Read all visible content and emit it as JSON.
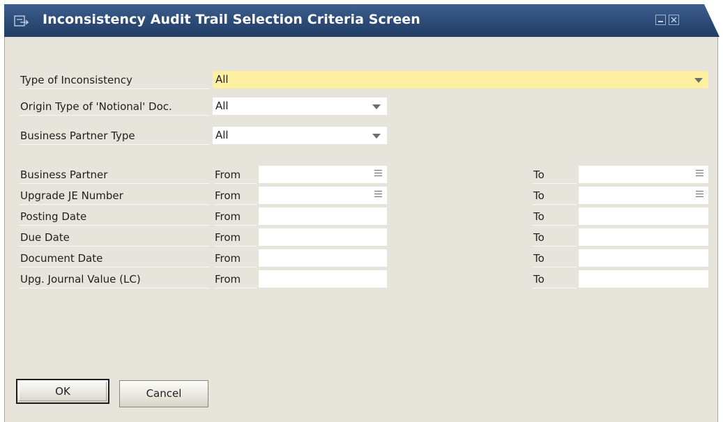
{
  "window": {
    "title": "Inconsistency Audit Trail Selection Criteria Screen"
  },
  "header_fields": [
    {
      "label": "Type of Inconsistency",
      "value": "All"
    },
    {
      "label": "Origin Type of 'Notional' Doc.",
      "value": "All"
    },
    {
      "label": "Business Partner Type",
      "value": "All"
    }
  ],
  "range": {
    "from_label": "From",
    "to_label": "To",
    "rows": [
      {
        "label": "Business Partner",
        "from_value": "",
        "to_value": ""
      },
      {
        "label": "Upgrade JE Number",
        "from_value": "",
        "to_value": ""
      },
      {
        "label": "Posting Date",
        "from_value": "",
        "to_value": ""
      },
      {
        "label": "Due Date",
        "from_value": "",
        "to_value": ""
      },
      {
        "label": "Document Date",
        "from_value": "",
        "to_value": ""
      },
      {
        "label": "Upg. Journal Value (LC)",
        "from_value": "",
        "to_value": ""
      }
    ]
  },
  "buttons": {
    "ok": "OK",
    "cancel": "Cancel"
  },
  "colors": {
    "titlebar": "#2c4a76",
    "window_bg": "#e7e4dc",
    "highlight_field": "#fdf0a0"
  },
  "icons": [
    "form-window-icon",
    "minimize-icon",
    "close-icon",
    "dropdown-arrow-icon",
    "choose-from-list-icon"
  ]
}
